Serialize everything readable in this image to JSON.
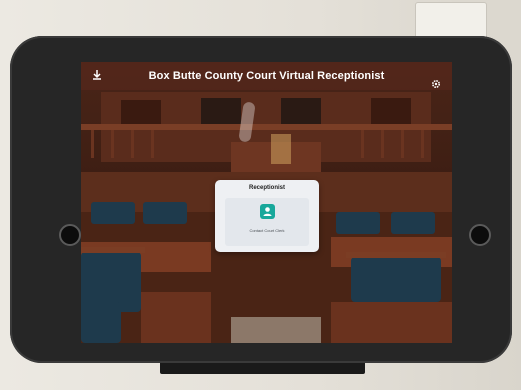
{
  "app": {
    "title": "Box Butte County Court Virtual Receptionist"
  },
  "toolbar": {
    "download_icon": "download-icon",
    "settings_icon": "gear-icon"
  },
  "dialog": {
    "title": "Receptionist",
    "contact_label": "Contact Court Clerk",
    "contact_icon": "person-icon",
    "accent_color": "#18a89b"
  }
}
